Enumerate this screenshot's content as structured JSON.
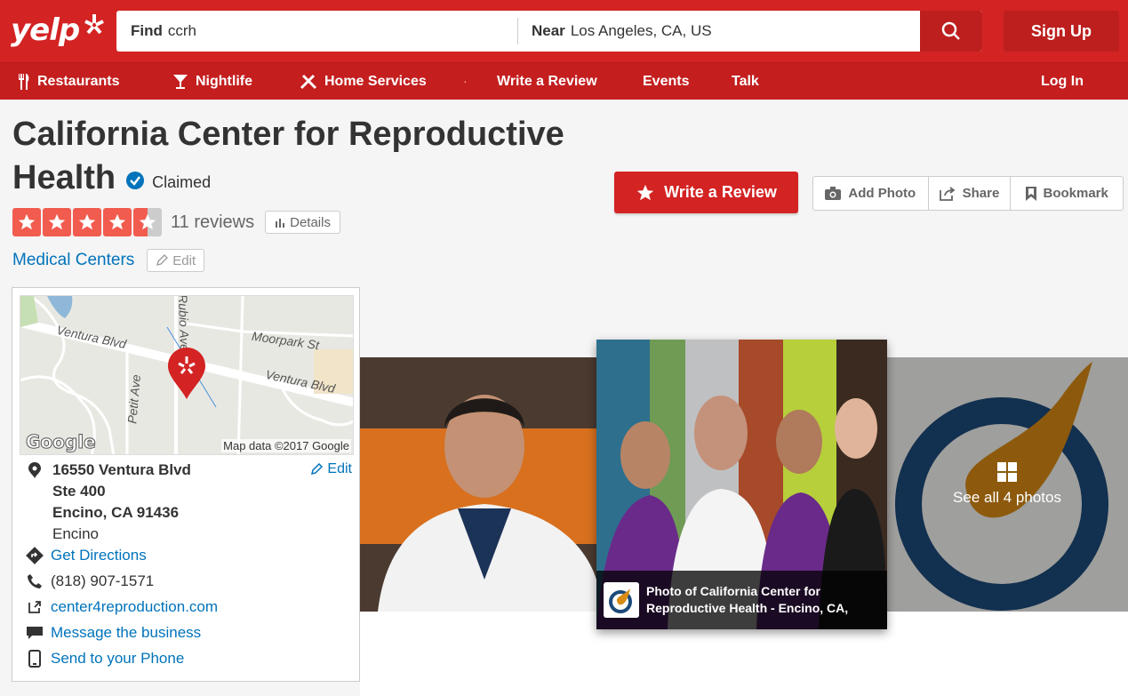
{
  "header": {
    "logo_text": "yelp",
    "find_label": "Find",
    "find_value": "ccrh",
    "near_label": "Near",
    "near_value": "Los Angeles, CA, US",
    "signup_label": "Sign Up",
    "brand_color": "#d32323"
  },
  "nav": {
    "items": [
      {
        "label": "Restaurants",
        "icon": "fork-knife-icon"
      },
      {
        "label": "Nightlife",
        "icon": "cocktail-icon"
      },
      {
        "label": "Home Services",
        "icon": "tools-icon"
      },
      {
        "label": "Write a Review"
      },
      {
        "label": "Events"
      },
      {
        "label": "Talk"
      }
    ],
    "login_label": "Log In"
  },
  "business": {
    "title_line1": "California Center for Reproductive",
    "title_line2": "Health",
    "claimed_label": "Claimed",
    "rating": 4.5,
    "review_count_label": "11 reviews",
    "details_label": "Details",
    "category": "Medical Centers",
    "edit_label": "Edit"
  },
  "actions": {
    "write_review": "Write a Review",
    "add_photo": "Add Photo",
    "share": "Share",
    "bookmark": "Bookmark"
  },
  "map": {
    "labels": [
      "Ventura Blvd",
      "Moorpark St",
      "Ventura Blvd",
      "Petit Ave",
      "Rubio Ave"
    ],
    "google_label": "Google",
    "attribution": "Map data ©2017 Google"
  },
  "address": {
    "line1": "16550 Ventura Blvd",
    "line2": "Ste 400",
    "line3": "Encino, CA 91436",
    "neighborhood": "Encino",
    "edit_label": "Edit"
  },
  "info": {
    "directions": "Get Directions",
    "phone": "(818) 907-1571",
    "website": "center4reproduction.com",
    "message": "Message the business",
    "send_phone": "Send to your Phone"
  },
  "photos": {
    "caption": "Photo of California Center for Reproductive Health - Encino, CA,",
    "see_all": "See all 4 photos"
  }
}
